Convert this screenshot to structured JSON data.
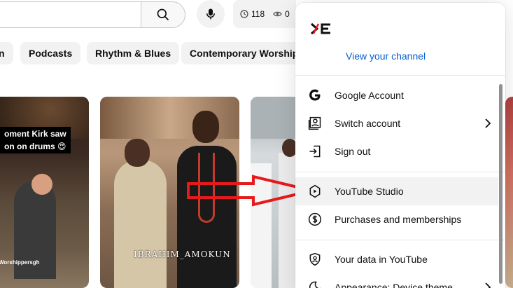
{
  "topbar": {
    "search_icon": "search-icon",
    "mic_icon": "microphone-icon",
    "stats": {
      "time_count": "118",
      "views_count": "0"
    }
  },
  "chips": [
    "n",
    "Podcasts",
    "Rhythm & Blues",
    "Contemporary Worship M"
  ],
  "thumbnails": {
    "t1": {
      "caption_line1": "oment Kirk saw",
      "caption_line2": "on on drums 😍",
      "watermark": "Worshippersgh"
    },
    "t2": {
      "watermark": "IBRAHIM_AMOKUN"
    }
  },
  "menu": {
    "view_channel": "View your channel",
    "items": [
      {
        "label": "Google Account",
        "icon": "google-icon"
      },
      {
        "label": "Switch account",
        "icon": "switch-account-icon"
      },
      {
        "label": "Sign out",
        "icon": "sign-out-icon"
      },
      {
        "label": "YouTube Studio",
        "icon": "youtube-studio-icon"
      },
      {
        "label": "Purchases and memberships",
        "icon": "dollar-icon"
      },
      {
        "label": "Your data in YouTube",
        "icon": "shield-person-icon"
      },
      {
        "label": "Appearance: Device theme",
        "icon": "moon-icon"
      }
    ]
  },
  "colors": {
    "link": "#065fd4",
    "arrow": "#e8191b",
    "chip_bg": "#f2f2f2"
  }
}
